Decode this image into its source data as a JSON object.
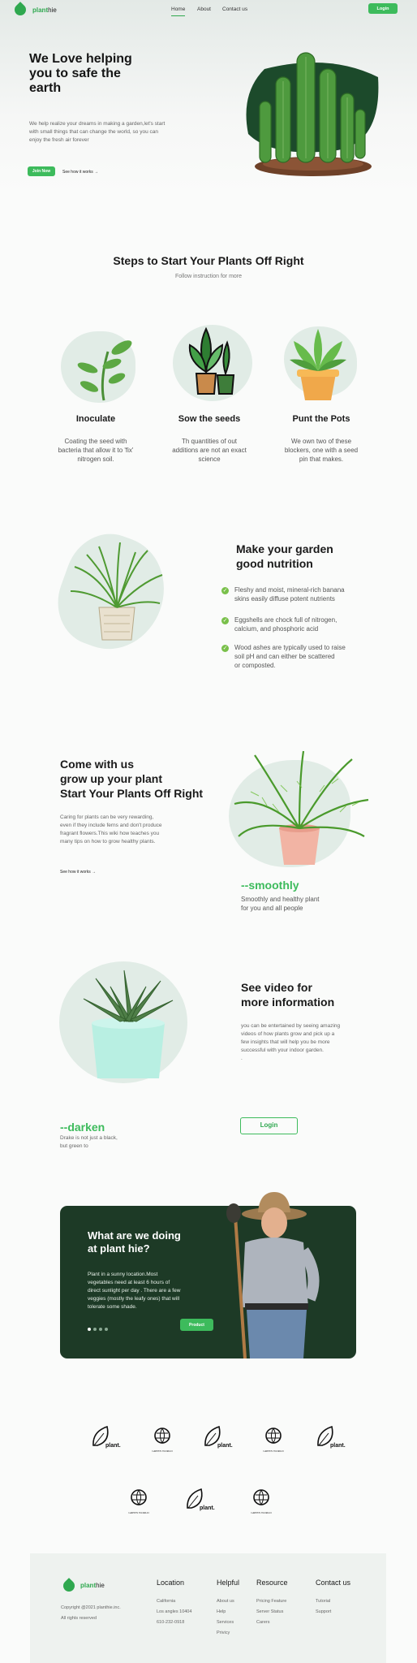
{
  "brand": {
    "name_green": "plant",
    "name_dark": "hie"
  },
  "nav": {
    "home": "Home",
    "about": "About",
    "contact": "Contact us",
    "login": "Login"
  },
  "hero": {
    "title_1": "We Love helping",
    "title_2": "you to safe the",
    "title_3": "earth",
    "desc_1": "We help realize your dreams in making a garden,let's start",
    "desc_2": "with small things that can change the world, so you can",
    "desc_3": "enjoy the fresh air forever",
    "join": "Join Now",
    "see": "See how it works →"
  },
  "steps": {
    "title": "Steps to Start Your Plants Off Right",
    "subtitle": "Follow instruction for more",
    "items": [
      {
        "title": "Inoculate",
        "l1": "Coating the seed with",
        "l2": "bacteria that allow it to 'fix'",
        "l3": "nitrogen soil."
      },
      {
        "title": "Sow the seeds",
        "l1": "Th quantities of out",
        "l2": "additions are not an exact",
        "l3": "science"
      },
      {
        "title": "Punt the Pots",
        "l1": "We own two of these",
        "l2": "blockers, one with a seed",
        "l3": "pin that makes."
      }
    ]
  },
  "nutrition": {
    "title_1": "Make your garden",
    "title_2": "good nutrition",
    "items": [
      {
        "l1": "Fleshy and moist, mineral-rich banana",
        "l2": "skins easily diffuse potent nutrients",
        "l3": ""
      },
      {
        "l1": "Eggshells are chock full of nitrogen,",
        "l2": "calcium, and phosphoric acid",
        "l3": ""
      },
      {
        "l1": "Wood ashes are typically used to raise",
        "l2": "soil pH and can either be scattered",
        "l3": "or composted."
      }
    ]
  },
  "grow": {
    "title_1": "Come with us",
    "title_2": "grow up your plant",
    "title_3": "Start Your Plants Off Right",
    "d1": "Caring for plants can be very rewarding,",
    "d2": "even if they include ferns and don't produce",
    "d3": "fragrant flowers.This wiki how teaches you",
    "d4": "many tips on how to grow healthy plants.",
    "see": "See how it works →",
    "smooth_title": "--smoothly",
    "smooth_1": "Smoothly and healthy plant",
    "smooth_2": "for you and all people"
  },
  "video": {
    "title_1": "See video for",
    "title_2": "more information",
    "d1": "you can be entertained by seeing amazing",
    "d2": "videos of how plants grow and pick up a",
    "d3": "few insights that will help you be more",
    "d4": "successful with your indoor garden.",
    "d5": ".",
    "darken_title": "--darken",
    "darken_1": "Drake is not just a black,",
    "darken_2": "but green to",
    "login": "Login"
  },
  "banner": {
    "title_1": "What are we doing",
    "title_2": "at plant hie?",
    "t1": "Plant in a sunny location.Most",
    "t2": "vegetables need at least 6 hours of",
    "t3": "direct sunlight per day . There are a few",
    "t4": "veggies (mostly the leafy ones) that will",
    "t5": "tolerate some shade.",
    "button": "Product"
  },
  "partners": {
    "plant": "plant.",
    "greens": "GREEN WORLD"
  },
  "footer": {
    "copyright_1": "Copyright @2021 planthie.inc.",
    "copyright_2": "All rights reserved",
    "cols": [
      {
        "head": "Location",
        "links": [
          "California",
          "Los angles 10404",
          "610-232-0918",
          ""
        ]
      },
      {
        "head": "Helpful",
        "links": [
          "About us",
          "Help",
          "Services",
          "Privicy"
        ]
      },
      {
        "head": "Resource",
        "links": [
          "Pricing Feature",
          "Server Status",
          "Carers",
          ""
        ]
      },
      {
        "head": "Contact us",
        "links": [
          "Tutorial",
          "Support",
          "",
          ""
        ]
      }
    ]
  },
  "colors": {
    "accent": "#3dbb5c",
    "dark_green": "#1d3a26",
    "blob": "#e1ece6"
  }
}
